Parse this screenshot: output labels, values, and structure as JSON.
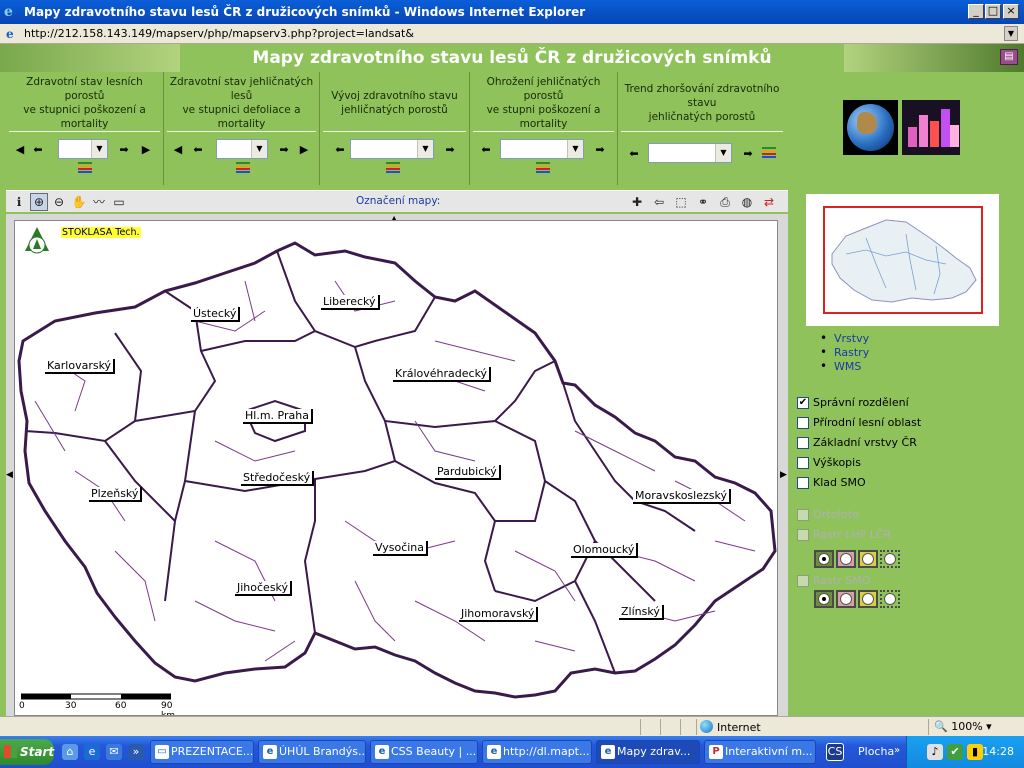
{
  "window": {
    "title": "Mapy zdravotního stavu lesů ČR z družicových snímků - Windows Internet Explorer",
    "min": "_",
    "max": "□",
    "close": "×"
  },
  "address": {
    "url": "http://212.158.143.149/mapserv/php/mapserv3.php?project=landsat&"
  },
  "page": {
    "title": "Mapy zdravotního stavu lesů ČR z družicových snímků"
  },
  "panels": [
    {
      "title": "Zdravotní stav lesních porostů ve stupnici poškození a mortality",
      "lines": [
        "Zdravotní stav lesních porostů",
        "ve stupnici poškození a",
        "mortality"
      ]
    },
    {
      "title": "Zdravotní stav jehličnatých lesů ve stupnici defoliace a mortality",
      "lines": [
        "Zdravotní stav jehličnatých",
        "lesů",
        "ve stupnici defoliace a",
        "mortality"
      ]
    },
    {
      "title": "Vývoj zdravotního stavu jehličnatých porostů",
      "lines": [
        "Vývoj zdravotního stavu",
        "jehličnatých porostů"
      ]
    },
    {
      "title": "Ohrožení jehličnatých porostů ve stupni poškození a mortality",
      "lines": [
        "Ohrožení jehličnatých",
        "porostů",
        "ve stupni poškození a",
        "mortality"
      ]
    },
    {
      "title": "Trend zhoršování zdravotního stavu jehličnatých porostů",
      "lines": [
        "Trend zhoršování zdravotního",
        "stavu",
        "jehličnatých porostů"
      ]
    }
  ],
  "toolbar": {
    "map_label": "Označení mapy:"
  },
  "map": {
    "logo_text": "STOKLASA Tech.",
    "regions": [
      {
        "name": "Karlovarský"
      },
      {
        "name": "Ústecký"
      },
      {
        "name": "Liberecký"
      },
      {
        "name": "Královéhradecký"
      },
      {
        "name": "Hl.m. Praha"
      },
      {
        "name": "Plzeňský"
      },
      {
        "name": "Středočeský"
      },
      {
        "name": "Pardubický"
      },
      {
        "name": "Moravskoslezský"
      },
      {
        "name": "Vysočina"
      },
      {
        "name": "Olomoucký"
      },
      {
        "name": "Jihočeský"
      },
      {
        "name": "Jihomoravský"
      },
      {
        "name": "Zlínský"
      }
    ],
    "scale_labels": [
      "0",
      "30",
      "60",
      "90 km"
    ]
  },
  "side_links": [
    "Vrstvy",
    "Rastry",
    "WMS"
  ],
  "layers": [
    {
      "label": "Správní rozdělení",
      "checked": true,
      "enabled": true
    },
    {
      "label": "Přírodní lesní oblast",
      "checked": false,
      "enabled": true
    },
    {
      "label": "Základní vrstvy ČR",
      "checked": false,
      "enabled": true
    },
    {
      "label": "Výškopis",
      "checked": false,
      "enabled": true
    },
    {
      "label": "Klad SMO",
      "checked": false,
      "enabled": true
    },
    {
      "label": "Ortofoto",
      "checked": false,
      "enabled": false
    },
    {
      "label": "Rastr LHP LČR",
      "checked": false,
      "enabled": false
    },
    {
      "label": "Rastr SMO",
      "checked": false,
      "enabled": false
    }
  ],
  "status": {
    "zone": "Internet",
    "zoom": "100%"
  },
  "taskbar": {
    "start": "Start",
    "tasks": [
      "PREZENTACE...",
      "ÚHÚL Brandýs...",
      "CSS Beauty | ...",
      "http://dl.mapt...",
      "Mapy zdrav...",
      "Interaktivní m..."
    ],
    "cs": "CS",
    "desktop": "Plocha",
    "clock": "14:28"
  },
  "colors": {
    "page_bg": "#8fc25a",
    "region_border": "#7a3a8a",
    "overview_frame": "#e02020"
  }
}
